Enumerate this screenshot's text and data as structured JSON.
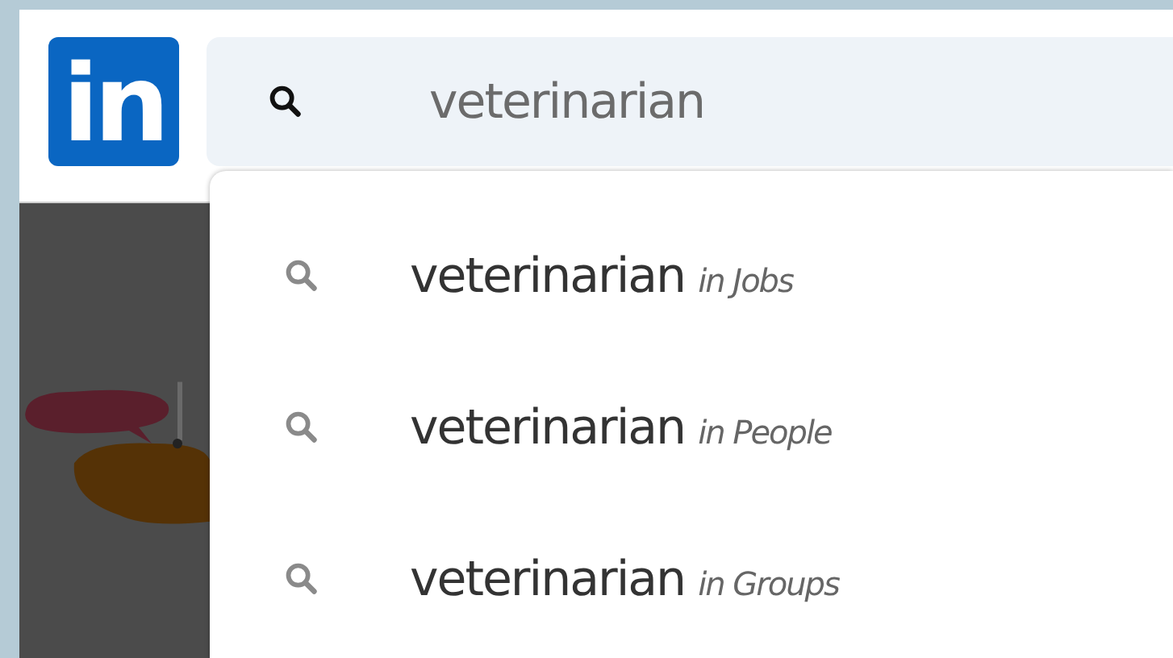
{
  "logo": {
    "text": "in"
  },
  "search": {
    "value": "veterinarian"
  },
  "suggestions": [
    {
      "query": "veterinarian",
      "scope": "in Jobs"
    },
    {
      "query": "veterinarian",
      "scope": "in People"
    },
    {
      "query": "veterinarian",
      "scope": "in Groups"
    }
  ]
}
